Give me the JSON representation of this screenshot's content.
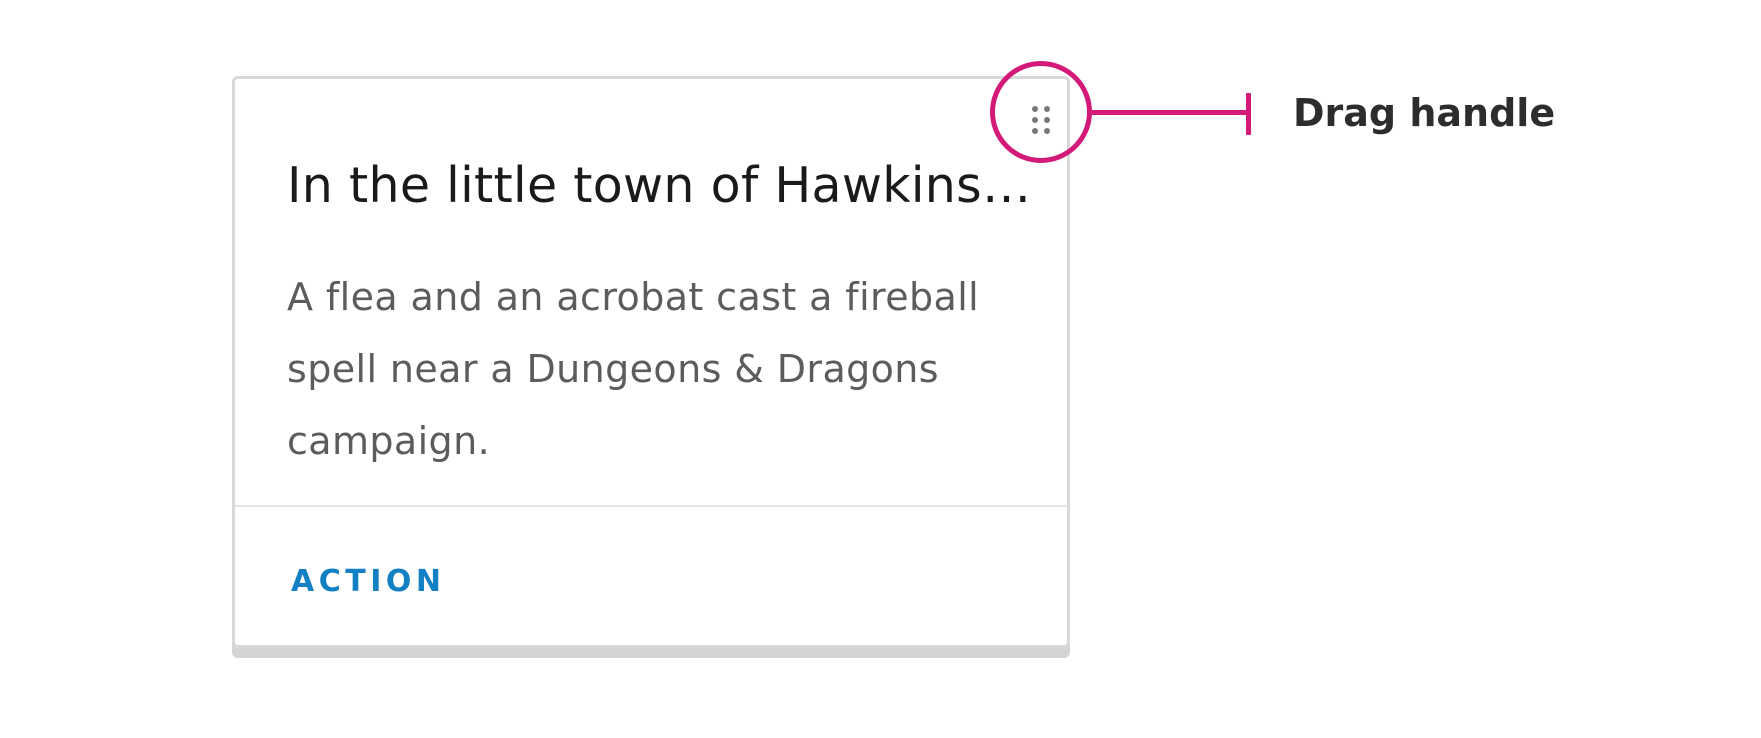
{
  "card": {
    "title": "In the little town of Hawkins…",
    "body": "A flea and an acrobat cast a fireball spell near a Dungeons & Dragons campaign.",
    "action_label": "ACTION"
  },
  "drag_handle": {
    "icon": "drag-dots-icon"
  },
  "callout": {
    "label": "Drag handle"
  },
  "colors": {
    "accent": "#1380c4",
    "callout": "#d41a78",
    "card_border": "#d8d8d8",
    "title_text": "#1a1a1a",
    "body_text": "#5c5c5c"
  }
}
